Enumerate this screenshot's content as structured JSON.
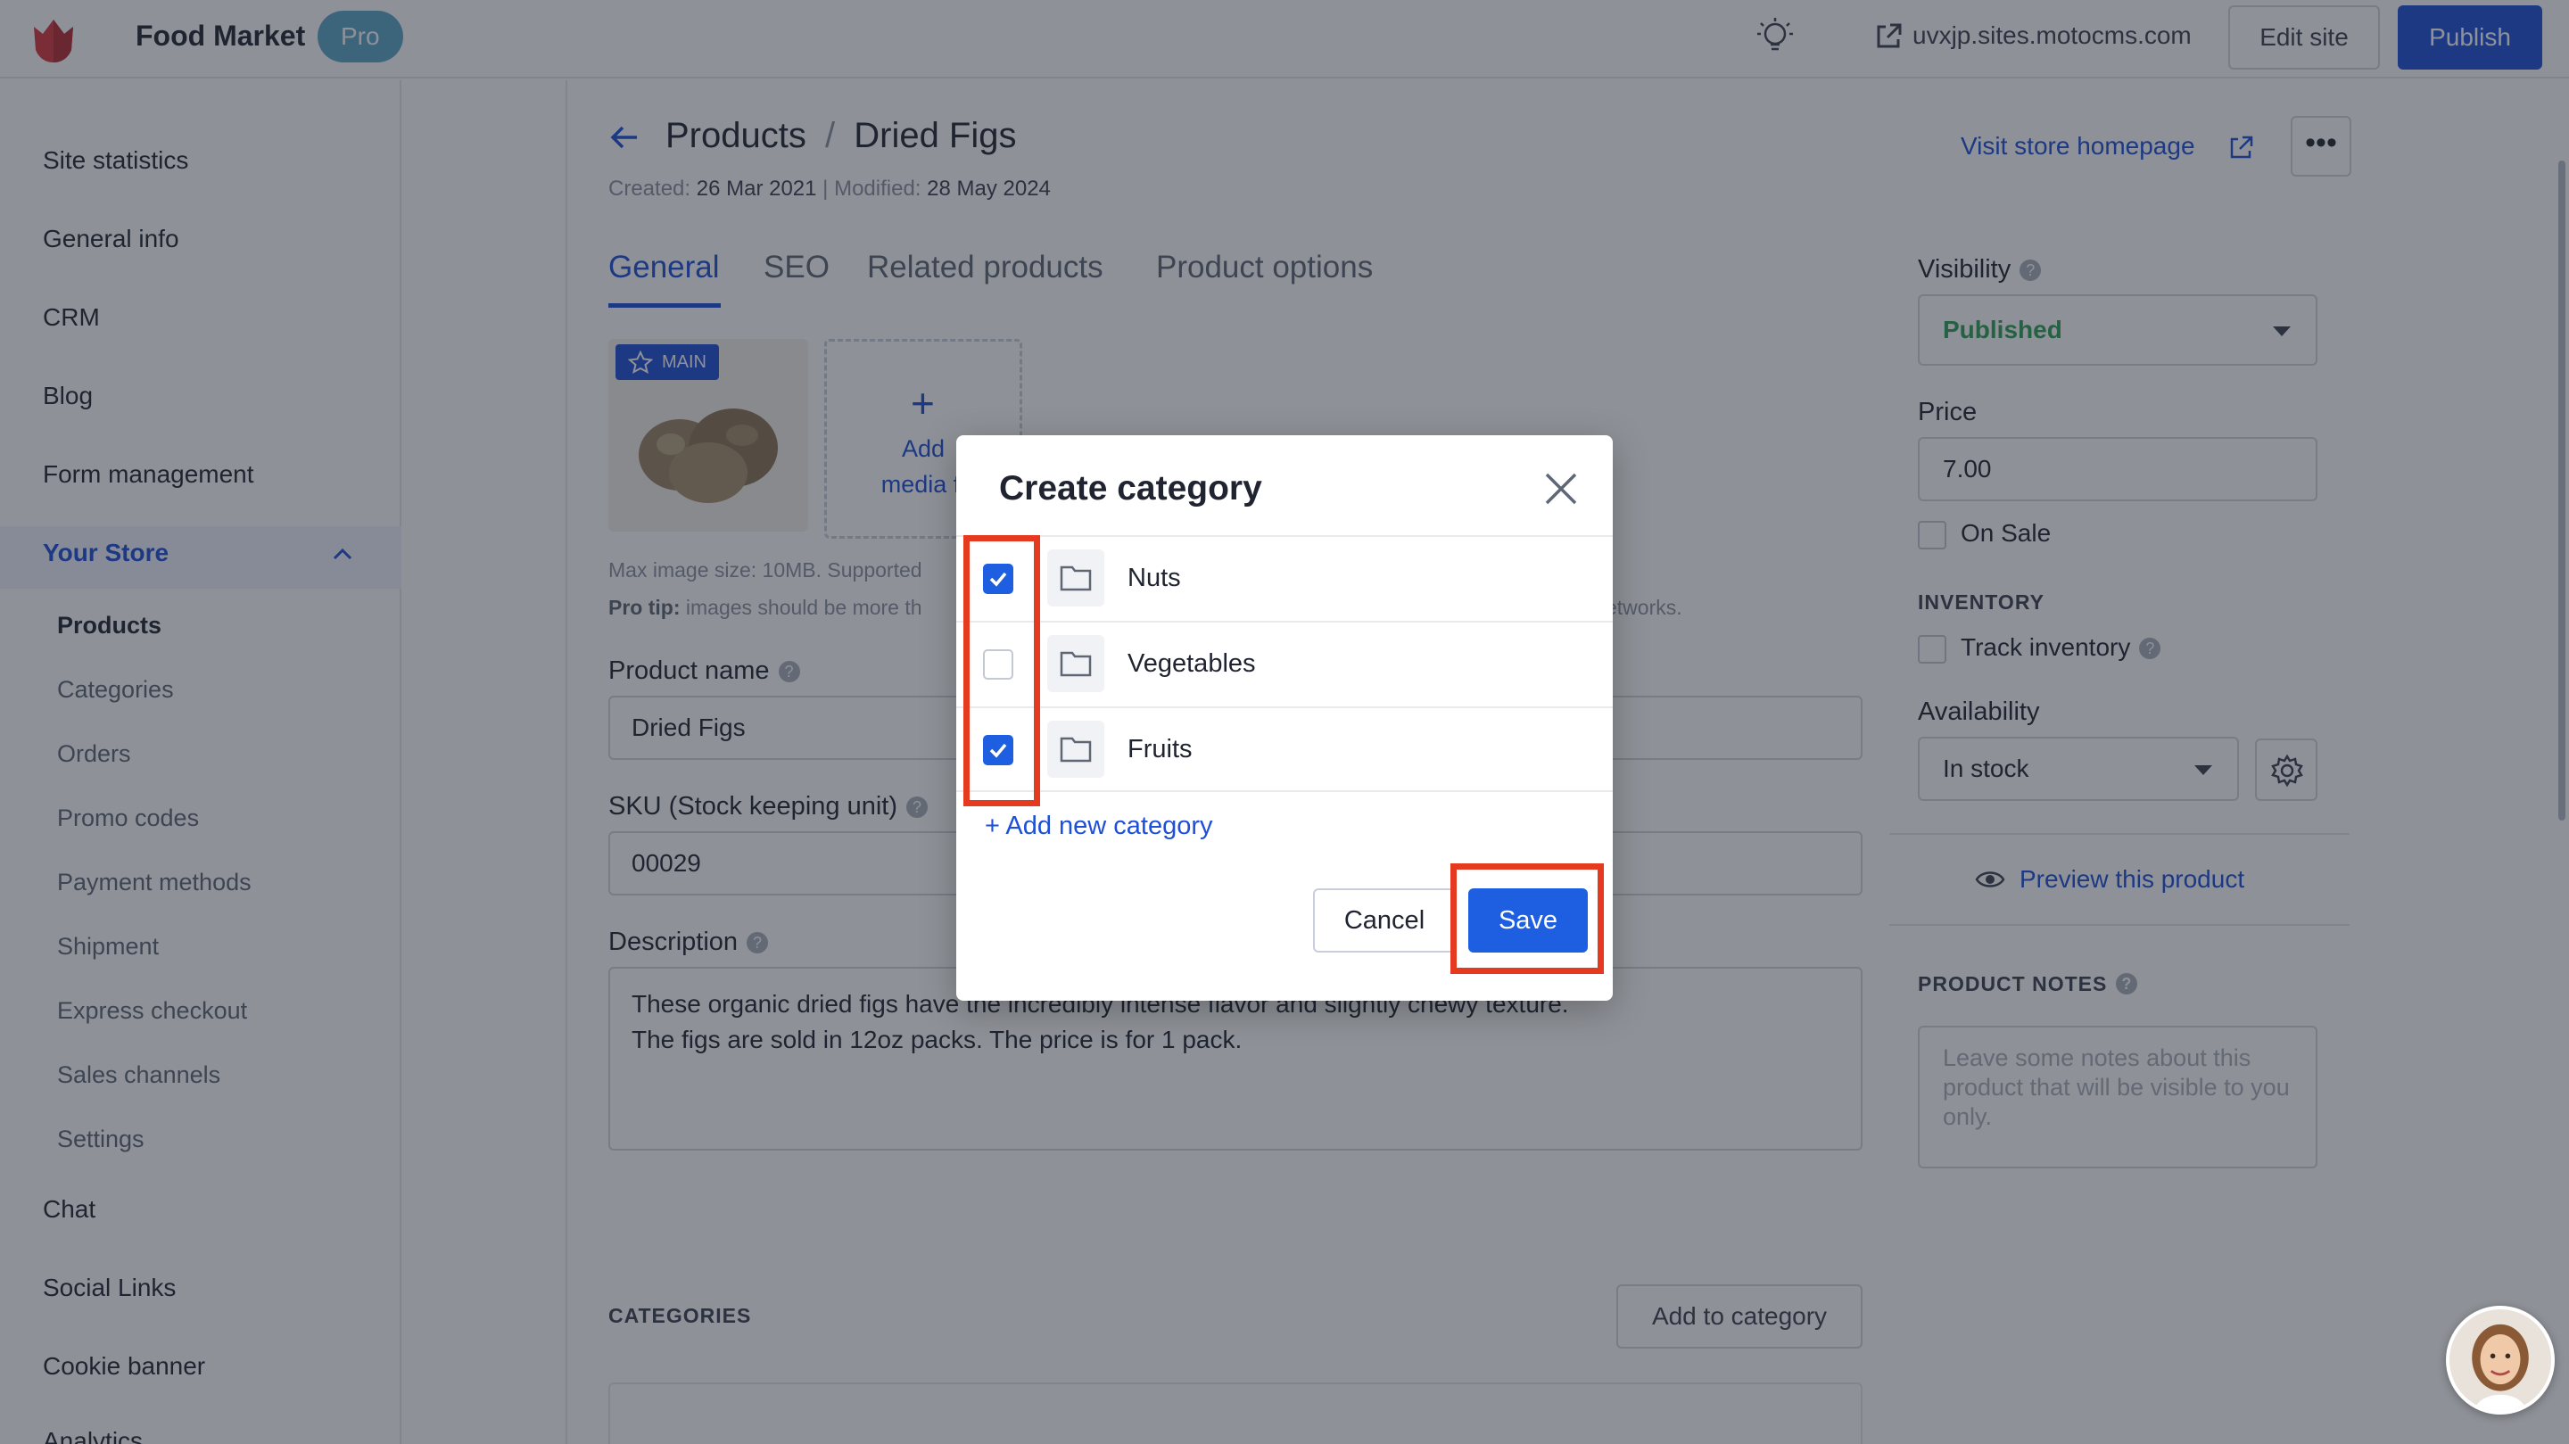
{
  "topbar": {
    "brand": "Food Market",
    "badge": "Pro",
    "site_url": "uvxjp.sites.motocms.com",
    "edit_label": "Edit site",
    "publish_label": "Publish"
  },
  "sidebar": {
    "items": [
      "Site statistics",
      "General info",
      "CRM",
      "Blog",
      "Form management"
    ],
    "store_label": "Your Store",
    "store_sub": [
      "Products",
      "Categories",
      "Orders",
      "Promo codes",
      "Payment methods",
      "Shipment",
      "Express checkout",
      "Sales channels",
      "Settings"
    ],
    "items_after": [
      "Chat",
      "Social Links",
      "Cookie banner",
      "Analytics"
    ]
  },
  "header": {
    "crumb_root": "Products",
    "crumb_sep": "/",
    "crumb_current": "Dried Figs",
    "created_label": "Created:",
    "created_date": "26 Mar 2021",
    "modified_label": "| Modified:",
    "modified_date": "28 May 2024",
    "visit_link": "Visit store homepage",
    "more_label": "•••"
  },
  "tabs": [
    "General",
    "SEO",
    "Related products",
    "Product options"
  ],
  "media": {
    "main_badge": "MAIN",
    "add_line1": "Add",
    "add_line2": "media fi",
    "help1": "Max image size: 10MB. Supported",
    "help2_bold": "Pro tip:",
    "help2": "images should be more th",
    "help_tail": "etworks."
  },
  "form": {
    "name_label": "Product name",
    "name_value": "Dried Figs",
    "sku_label": "SKU (Stock keeping unit)",
    "sku_value": "00029",
    "desc_label": "Description",
    "desc_line1": "These organic dried figs have the incredibly intense flavor and slightly chewy texture.",
    "desc_line2": "The figs are sold in 12oz packs. The price is for 1 pack.",
    "categories_title": "CATEGORIES",
    "add_to_category": "Add to category"
  },
  "right_panel": {
    "visibility_label": "Visibility",
    "visibility_value": "Published",
    "price_label": "Price",
    "price_value": "7.00",
    "on_sale": "On Sale",
    "inventory_title": "INVENTORY",
    "track_inventory": "Track inventory",
    "availability_label": "Availability",
    "availability_value": "In stock",
    "preview_link": "Preview this product",
    "notes_title": "PRODUCT NOTES",
    "notes_placeholder": "Leave some notes about this product that will be visible to you only."
  },
  "modal": {
    "title": "Create category",
    "rows": [
      {
        "label": "Nuts",
        "checked": true
      },
      {
        "label": "Vegetables",
        "checked": false
      },
      {
        "label": "Fruits",
        "checked": true
      }
    ],
    "add_new": "+ Add new category",
    "cancel_label": "Cancel",
    "save_label": "Save"
  },
  "colors": {
    "accent": "#1d4fd8",
    "highlight": "#e53a1f",
    "overlay": "rgba(30,35,48,0.5)"
  }
}
